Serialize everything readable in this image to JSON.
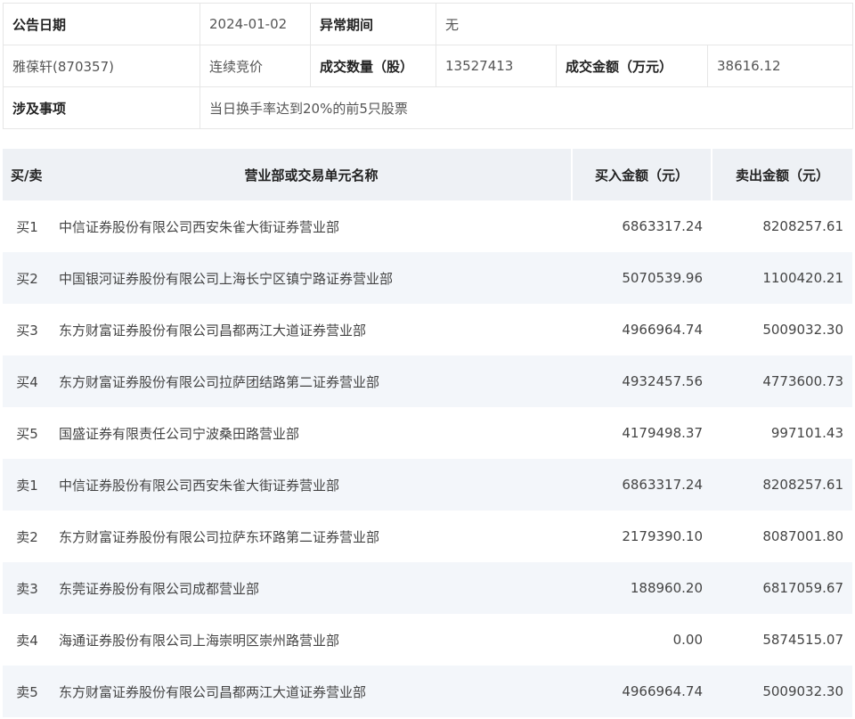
{
  "info": {
    "announce_date_label": "公告日期",
    "announce_date": "2024-01-02",
    "abnormal_period_label": "异常期间",
    "abnormal_period": "无",
    "stock": "雅葆轩(870357)",
    "trade_method": "连续竞价",
    "volume_label": "成交数量（股）",
    "volume": "13527413",
    "amount_label": "成交金额（万元）",
    "amount": "38616.12",
    "matter_label": "涉及事项",
    "matter": "当日换手率达到20%的前5只股票"
  },
  "table": {
    "headers": [
      "买/卖",
      "营业部或交易单元名称",
      "买入金额（元）",
      "卖出金额（元）"
    ],
    "rows": [
      [
        "买1",
        "中信证券股份有限公司西安朱雀大街证券营业部",
        "6863317.24",
        "8208257.61"
      ],
      [
        "买2",
        "中国银河证券股份有限公司上海长宁区镇宁路证券营业部",
        "5070539.96",
        "1100420.21"
      ],
      [
        "买3",
        "东方财富证券股份有限公司昌都两江大道证券营业部",
        "4966964.74",
        "5009032.30"
      ],
      [
        "买4",
        "东方财富证券股份有限公司拉萨团结路第二证券营业部",
        "4932457.56",
        "4773600.73"
      ],
      [
        "买5",
        "国盛证券有限责任公司宁波桑田路营业部",
        "4179498.37",
        "997101.43"
      ],
      [
        "卖1",
        "中信证券股份有限公司西安朱雀大街证券营业部",
        "6863317.24",
        "8208257.61"
      ],
      [
        "卖2",
        "东方财富证券股份有限公司拉萨东环路第二证券营业部",
        "2179390.10",
        "8087001.80"
      ],
      [
        "卖3",
        "东莞证券股份有限公司成都营业部",
        "188960.20",
        "6817059.67"
      ],
      [
        "卖4",
        "海通证券股份有限公司上海崇明区崇州路营业部",
        "0.00",
        "5874515.07"
      ],
      [
        "卖5",
        "东方财富证券股份有限公司昌都两江大道证券营业部",
        "4966964.74",
        "5009032.30"
      ]
    ]
  }
}
